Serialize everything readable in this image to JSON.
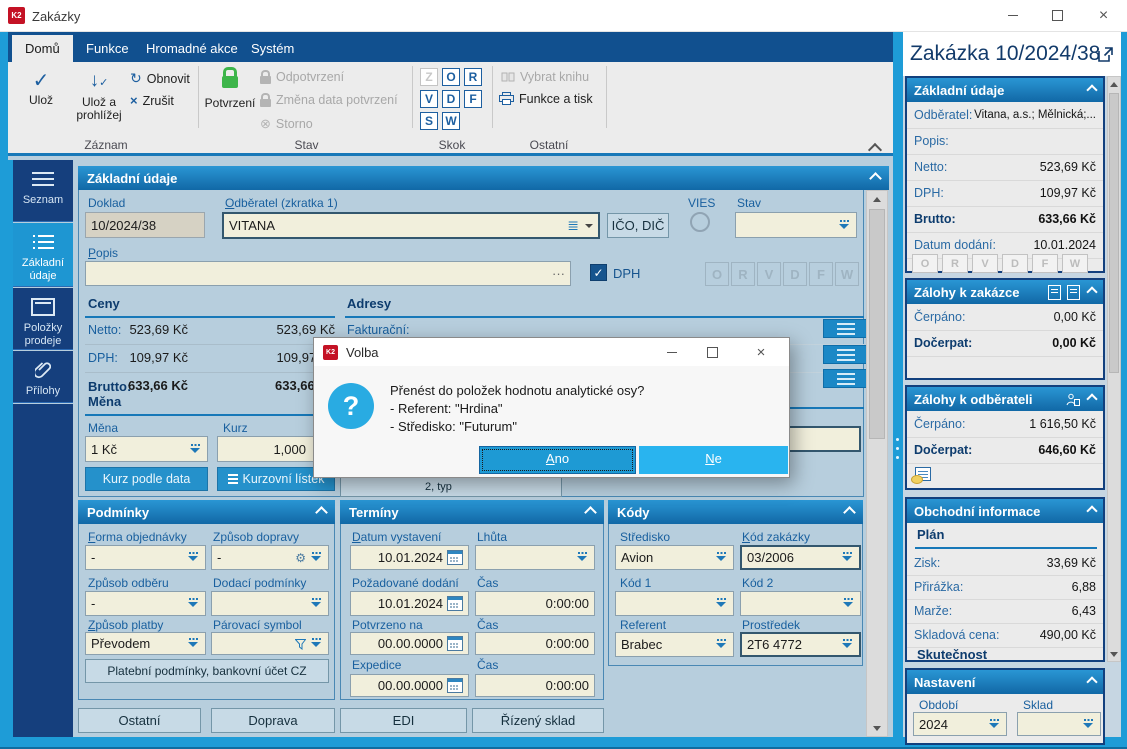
{
  "window": {
    "title": "Zakázky"
  },
  "colors": {
    "accent_cyan": "#1e9cd7",
    "tab_navy": "#11508f",
    "header_blue": "#1777b4",
    "field_yellow": "#f1efdc",
    "confirm_green": "#3db54a",
    "dialog_btn_ano": "#1e9ad4",
    "dialog_btn_ne": "#29b4ef"
  },
  "ribbon": {
    "tabs": [
      {
        "label": "Domů"
      },
      {
        "label": "Funkce"
      },
      {
        "label": "Hromadné akce"
      },
      {
        "label": "Systém"
      }
    ],
    "zaznam": {
      "label": "Záznam",
      "uloz": "Ulož",
      "uloz_a_prohlizej": "Ulož a prohlížej",
      "obnovit": "Obnovit",
      "zrusit": "Zrušit"
    },
    "stav": {
      "label": "Stav",
      "potvrzeni": "Potvrzení",
      "odpotvrzeni": "Odpotvrzení",
      "zmena": "Změna data potvrzení",
      "storno": "Storno"
    },
    "skok": {
      "label": "Skok",
      "letters": [
        "Z",
        "O",
        "R",
        "V",
        "D",
        "F",
        "S",
        "W"
      ]
    },
    "ostatni": {
      "label": "Ostatní",
      "vybrat_knihu": "Vybrat knihu",
      "funkce_a_tisk": "Funkce a tisk"
    }
  },
  "sidebar": {
    "items": [
      "Seznam",
      "Základní údaje",
      "Položky prodeje",
      "Přílohy"
    ]
  },
  "main": {
    "title": "Základní údaje",
    "doklad": {
      "label": "Doklad",
      "value": "10/2024/38"
    },
    "odberatel": {
      "label": "Odběratel (zkratka 1)",
      "value": "VITANA"
    },
    "ico_dic": "IČO, DIČ",
    "vies": "VIES",
    "stav_label": "Stav",
    "popis_label": "Popis",
    "dots": "···",
    "dph": "DPH",
    "letters": [
      "O",
      "R",
      "V",
      "D",
      "F",
      "W"
    ],
    "ceny": {
      "title": "Ceny",
      "rows": [
        {
          "label": "Netto:",
          "v1": "523,69 Kč",
          "v2": "523,69 Kč"
        },
        {
          "label": "DPH:",
          "v1": "109,97 Kč",
          "v2": "109,97 Kč"
        },
        {
          "label": "Brutto:",
          "v1": "633,66 Kč",
          "v2": "633,66 Kč"
        }
      ]
    },
    "adresy": {
      "title": "Adresy",
      "fakturacni": "Fakturační:"
    },
    "mena": {
      "title": "Měna",
      "mena_label": "Měna",
      "mena_value": "1 Kč",
      "kurz_label": "Kurz",
      "kurz_value": "1,000",
      "btn_kurz": "Kurz podle data",
      "btn_listek": "Kurzovní lístek"
    },
    "partial_button": "2, typ",
    "podminky": {
      "title": "Podmínky",
      "forma_label": "Forma objednávky",
      "forma_value": "-",
      "doprava_label": "Způsob dopravy",
      "doprava_value": "-",
      "odber_label": "Způsob odběru",
      "odber_value": "-",
      "dodaci_label": "Dodací podmínky",
      "dodaci_value": "",
      "platba_label": "Způsob platby",
      "platba_value": "Převodem",
      "parovaci_label": "Párovací symbol",
      "parovaci_value": "",
      "platebni_btn": "Platební podmínky, bankovní účet CZ"
    },
    "terminy": {
      "title": "Termíny",
      "vystaveni_label": "Datum vystavení",
      "vystaveni_value": "10.01.2024",
      "lhuta_label": "Lhůta",
      "lhuta_value": "",
      "dodani_label": "Požadované dodání",
      "dodani_value": "10.01.2024",
      "cas1_label": "Čas",
      "cas1_value": "0:00:00",
      "potvrzeno_label": "Potvrzeno na",
      "potvrzeno_value": "00.00.0000",
      "cas2_label": "Čas",
      "cas2_value": "0:00:00",
      "expedice_label": "Expedice",
      "expedice_value": "00.00.0000",
      "cas3_label": "Čas",
      "cas3_value": "0:00:00"
    },
    "kody": {
      "title": "Kódy",
      "stredisko_label": "Středisko",
      "stredisko_value": "Avion",
      "kod_zakazky_label": "Kód zakázky",
      "kod_zakazky_value": "03/2006",
      "kod1_label": "Kód 1",
      "kod1_value": "",
      "kod2_label": "Kód 2",
      "kod2_value": "",
      "referent_label": "Referent",
      "referent_value": "Brabec",
      "prostredek_label": "Prostředek",
      "prostredek_value": "2T6 4772"
    },
    "bottom_buttons": {
      "ostatni": "Ostatní",
      "doprava": "Doprava",
      "edi": "EDI",
      "rizeny_sklad": "Řízený sklad"
    }
  },
  "dialog": {
    "title": "Volba",
    "line1": "Přenést do položek hodnotu analytické osy?",
    "line2": "- Referent: \"Hrdina\"",
    "line3": "- Středisko: \"Futurum\"",
    "ano": "Ano",
    "ne": "Ne"
  },
  "right_panel": {
    "title": "Zakázka 10/2024/38",
    "zakladni": {
      "title": "Základní údaje",
      "rows": [
        {
          "label": "Odběratel:",
          "value": "Vitana, a.s.; Mělnická;..."
        },
        {
          "label": "Popis:",
          "value": ""
        },
        {
          "label": "Netto:",
          "value": "523,69 Kč"
        },
        {
          "label": "DPH:",
          "value": "109,97 Kč"
        },
        {
          "label": "Brutto:",
          "value": "633,66 Kč"
        },
        {
          "label": "Datum dodání:",
          "value": "10.01.2024"
        }
      ],
      "letters": [
        "O",
        "R",
        "V",
        "D",
        "F",
        "W"
      ]
    },
    "zalohy_zakazka": {
      "title": "Zálohy k zakázce",
      "rows": [
        {
          "label": "Čerpáno:",
          "value": "0,00 Kč"
        },
        {
          "label": "Dočerpat:",
          "value": "0,00 Kč"
        }
      ]
    },
    "zalohy_odberatel": {
      "title": "Zálohy k odběrateli",
      "rows": [
        {
          "label": "Čerpáno:",
          "value": "1 616,50 Kč"
        },
        {
          "label": "Dočerpat:",
          "value": "646,60 Kč"
        }
      ]
    },
    "obchodni": {
      "title": "Obchodní informace",
      "plan": "Plán",
      "rows": [
        {
          "label": "Zisk:",
          "value": "33,69 Kč"
        },
        {
          "label": "Přirážka:",
          "value": "6,88"
        },
        {
          "label": "Marže:",
          "value": "6,43"
        },
        {
          "label": "Skladová cena:",
          "value": "490,00 Kč"
        }
      ],
      "skutecnost": "Skutečnost"
    },
    "nastaveni": {
      "title": "Nastavení",
      "obdobi_label": "Období",
      "obdobi_value": "2024",
      "sklad_label": "Sklad",
      "sklad_value": ""
    }
  }
}
